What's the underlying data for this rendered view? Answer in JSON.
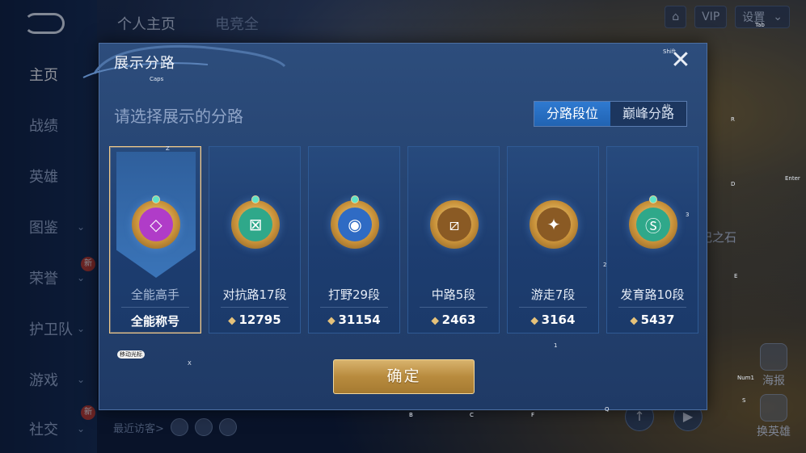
{
  "background": {
    "top_tabs": [
      "个人主页",
      "电竞全"
    ],
    "sidebar_items": [
      {
        "label": "主页",
        "active": true
      },
      {
        "label": "战绩"
      },
      {
        "label": "英雄"
      },
      {
        "label": "图鉴",
        "chevron": true
      },
      {
        "label": "荣誉",
        "chevron": true,
        "badge": "新"
      },
      {
        "label": "护卫队",
        "chevron": true
      },
      {
        "label": "游戏",
        "chevron": true
      },
      {
        "label": "社交",
        "chevron": true,
        "badge": "新"
      }
    ],
    "topbar": {
      "vip_label": "VIP",
      "settings_label": "设置"
    },
    "recent_visitors_label": "最近访客>",
    "right_widgets": [
      {
        "label": "海报"
      },
      {
        "label": "换英雄"
      }
    ],
    "bg_text": "记之石",
    "key_hints": [
      "Caps",
      "Tab",
      "Shift",
      "Alt",
      "R",
      "D",
      "Enter",
      "E",
      "Z",
      "X",
      "B",
      "C",
      "F",
      "Q",
      "1",
      "2",
      "3",
      "Num1",
      "S",
      "移动光标"
    ]
  },
  "modal": {
    "title": "展示分路",
    "close_icon": "close-icon",
    "subtitle": "请选择展示的分路",
    "segments": [
      {
        "label": "分路段位",
        "selected": true
      },
      {
        "label": "巅峰分路",
        "selected": false
      }
    ],
    "cards": [
      {
        "lane": "全能高手",
        "score": "全能称号",
        "selected": true,
        "emblem": "all-round-emblem-icon",
        "emblem_color": "#b03cc8",
        "glyph": "◇"
      },
      {
        "lane": "对抗路17段",
        "score": "12795",
        "selected": false,
        "emblem": "clash-lane-emblem-icon",
        "emblem_color": "#2fa88a",
        "glyph": "⊠"
      },
      {
        "lane": "打野29段",
        "score": "31154",
        "selected": false,
        "emblem": "jungle-emblem-icon",
        "emblem_color": "#2f6bc4",
        "glyph": "◉"
      },
      {
        "lane": "中路5段",
        "score": "2463",
        "selected": false,
        "emblem": "mid-lane-emblem-icon",
        "emblem_color": "#8a5a24",
        "glyph": "⧄"
      },
      {
        "lane": "游走7段",
        "score": "3164",
        "selected": false,
        "emblem": "roam-emblem-icon",
        "emblem_color": "#8a5a24",
        "glyph": "✦"
      },
      {
        "lane": "发育路10段",
        "score": "5437",
        "selected": false,
        "emblem": "farm-lane-emblem-icon",
        "emblem_color": "#2fa88a",
        "glyph": "Ⓢ"
      }
    ],
    "confirm_label": "确定"
  }
}
